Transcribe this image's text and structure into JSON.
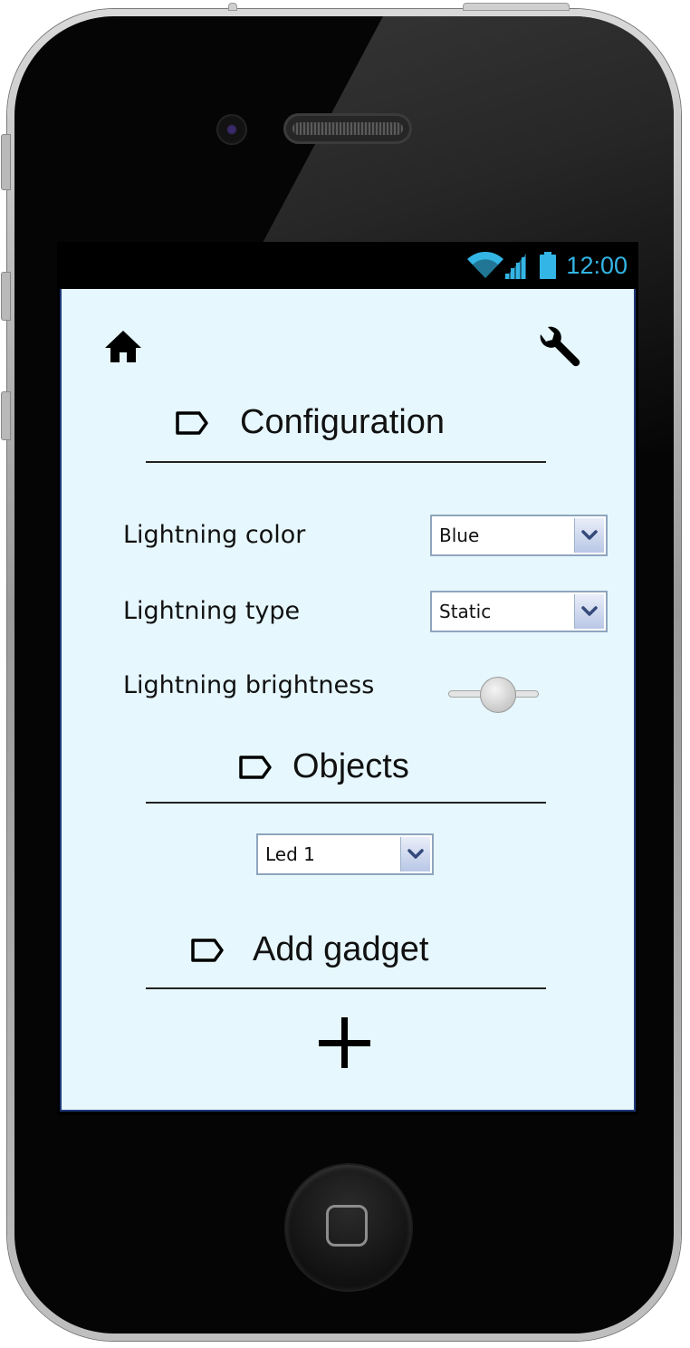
{
  "status_bar": {
    "time": "12:00",
    "icons": [
      "wifi-icon",
      "signal-icon",
      "battery-icon"
    ]
  },
  "top_bar": {
    "left_icon": "home-icon",
    "right_icon": "wrench-icon"
  },
  "configuration": {
    "title": "Configuration",
    "color_label": "Lightning color",
    "color_value": "Blue",
    "type_label": "Lightning type",
    "type_value": "Static",
    "brightness_label": "Lightning brightness",
    "brightness_level": 0.5
  },
  "objects": {
    "title": "Objects",
    "selected": "Led 1"
  },
  "add_gadget": {
    "title": "Add gadget",
    "icon": "plus-icon"
  },
  "colors": {
    "screen_bg": "#e6f7fd",
    "status_accent": "#33b5e5",
    "frame": "#050505"
  }
}
